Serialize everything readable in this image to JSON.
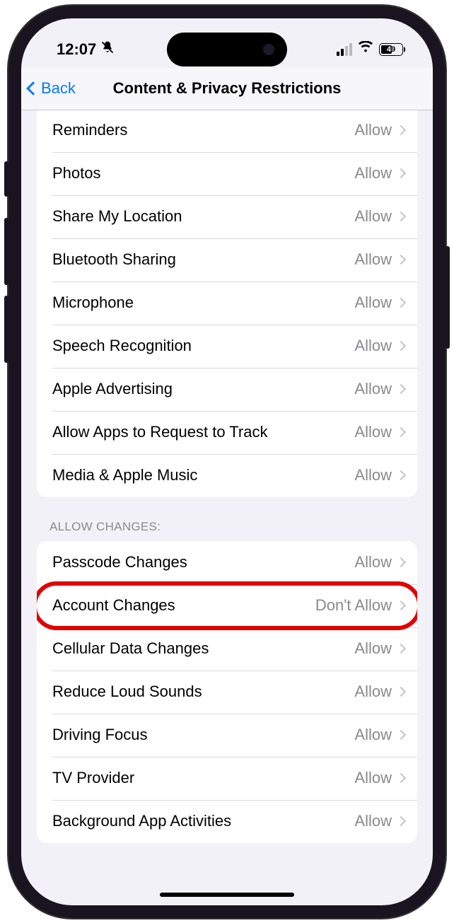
{
  "status": {
    "time": "12:07",
    "battery": "49"
  },
  "nav": {
    "back": "Back",
    "title": "Content & Privacy Restrictions"
  },
  "section1": {
    "items": [
      {
        "label": "Reminders",
        "value": "Allow"
      },
      {
        "label": "Photos",
        "value": "Allow"
      },
      {
        "label": "Share My Location",
        "value": "Allow"
      },
      {
        "label": "Bluetooth Sharing",
        "value": "Allow"
      },
      {
        "label": "Microphone",
        "value": "Allow"
      },
      {
        "label": "Speech Recognition",
        "value": "Allow"
      },
      {
        "label": "Apple Advertising",
        "value": "Allow"
      },
      {
        "label": "Allow Apps to Request to Track",
        "value": "Allow"
      },
      {
        "label": "Media & Apple Music",
        "value": "Allow"
      }
    ]
  },
  "section2": {
    "header": "Allow Changes:",
    "items": [
      {
        "label": "Passcode Changes",
        "value": "Allow"
      },
      {
        "label": "Account Changes",
        "value": "Don't Allow",
        "highlight": true
      },
      {
        "label": "Cellular Data Changes",
        "value": "Allow"
      },
      {
        "label": "Reduce Loud Sounds",
        "value": "Allow"
      },
      {
        "label": "Driving Focus",
        "value": "Allow"
      },
      {
        "label": "TV Provider",
        "value": "Allow"
      },
      {
        "label": "Background App Activities",
        "value": "Allow"
      }
    ]
  }
}
